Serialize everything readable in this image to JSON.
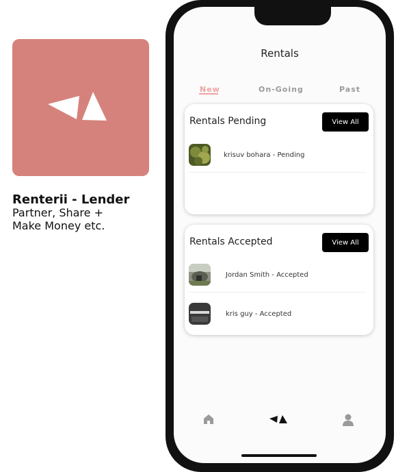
{
  "promo": {
    "app_name": "Renterii - Lender",
    "tagline": "Partner, Share + Make Money etc.",
    "icon": "renterii-logo-icon",
    "accent_color": "#d6827c"
  },
  "screen": {
    "title": "Rentals",
    "tabs": [
      {
        "label": "New",
        "active": true
      },
      {
        "label": "On-Going",
        "active": false
      },
      {
        "label": "Past",
        "active": false
      }
    ]
  },
  "pending": {
    "title": "Rentals Pending",
    "view_all_label": "View All",
    "items": [
      {
        "text": "krisuv bohara - Pending",
        "avatar": "green-foliage-photo"
      }
    ]
  },
  "accepted": {
    "title": "Rentals Accepted",
    "view_all_label": "View All",
    "items": [
      {
        "text": "Jordan Smith - Accepted",
        "avatar": "stone-landscape-photo"
      },
      {
        "text": "kris guy - Accepted",
        "avatar": "dark-poster-photo"
      }
    ]
  },
  "tabbar": {
    "items": [
      "home-icon",
      "renterii-logo-icon",
      "profile-icon"
    ]
  }
}
